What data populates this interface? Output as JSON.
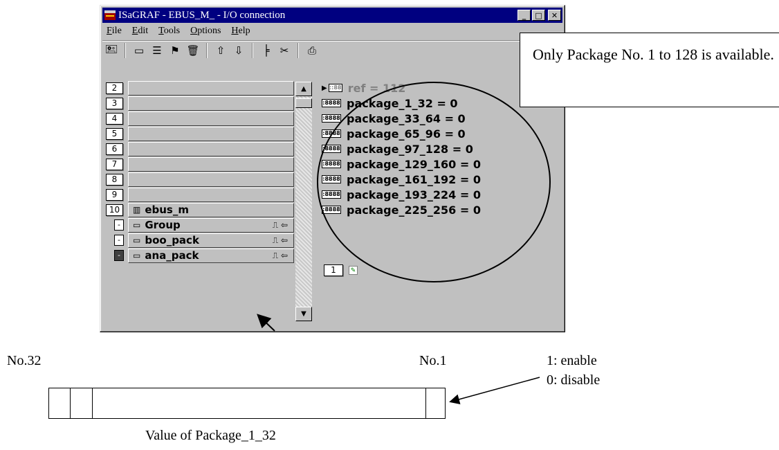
{
  "window": {
    "title": "ISaGRAF - EBUS_M_ - I/O connection",
    "buttons": {
      "minimize": "_",
      "maximize": "□",
      "close": "✕"
    }
  },
  "menu": [
    "File",
    "Edit",
    "Tools",
    "Options",
    "Help"
  ],
  "toolbar": {
    "icons": [
      "connect-icon",
      "board-icon",
      "board-list-icon",
      "help-board-icon",
      "delete-icon",
      "move-up-icon",
      "move-down-icon",
      "tree-icon",
      "cut-icon",
      "print-icon"
    ],
    "glyphs": {
      "connect": "🖭",
      "board": "▭",
      "board_list": "☰",
      "help_board": "⚑",
      "delete": "🗑",
      "up": "⇧",
      "down": "⇩",
      "tree": "╞",
      "cut": "✂",
      "print": "⎙"
    }
  },
  "slots": [
    {
      "num": "2",
      "label": ""
    },
    {
      "num": "3",
      "label": ""
    },
    {
      "num": "4",
      "label": ""
    },
    {
      "num": "5",
      "label": ""
    },
    {
      "num": "6",
      "label": ""
    },
    {
      "num": "7",
      "label": ""
    },
    {
      "num": "8",
      "label": ""
    },
    {
      "num": "9",
      "label": ""
    },
    {
      "num": "10",
      "label": "ebus_m"
    }
  ],
  "sub_items": [
    {
      "marker": "-",
      "label": "Group",
      "flags": "⎍ ⇦"
    },
    {
      "marker": "-",
      "label": "boo_pack",
      "flags": "⎍ ⇦"
    },
    {
      "marker": "-",
      "label": "ana_pack",
      "flags": "⎍ ⇦"
    }
  ],
  "variables": {
    "ref": {
      "icon": "::88",
      "text": "ref = 112"
    },
    "items": [
      {
        "icon": ":8888",
        "text": "package_1_32 = 0"
      },
      {
        "icon": ":8888",
        "text": "package_33_64 = 0"
      },
      {
        "icon": ":8888",
        "text": "package_65_96 = 0"
      },
      {
        "icon": ":8888",
        "text": "package_97_128 = 0"
      },
      {
        "icon": ":8888",
        "text": "package_129_160 = 0"
      },
      {
        "icon": ":8888",
        "text": "package_161_192 = 0"
      },
      {
        "icon": ":8888",
        "text": "package_193_224 = 0"
      },
      {
        "icon": ":8888",
        "text": "package_225_256 = 0"
      }
    ],
    "channel": "1"
  },
  "callout": "Only Package No. 1 to 128 is available.",
  "register": {
    "left_label": "No.32",
    "right_label": "No.1",
    "enable": "1: enable",
    "disable": "0: disable",
    "caption": "Value of Package_1_32"
  }
}
